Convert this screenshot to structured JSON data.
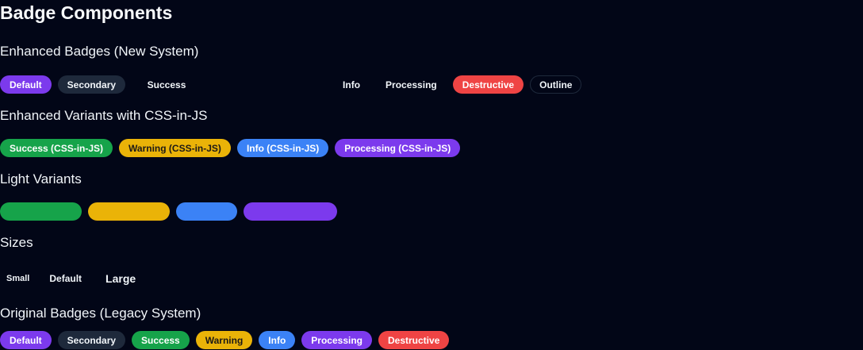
{
  "page": {
    "title": "Badge Components"
  },
  "enhanced": {
    "heading": "Enhanced Badges (New System)",
    "badges": {
      "default": "Default",
      "secondary": "Secondary",
      "success": "Success",
      "warning": "",
      "info": "Info",
      "processing": "Processing",
      "destructive": "Destructive",
      "outline": "Outline"
    }
  },
  "css_in_js": {
    "heading": "Enhanced Variants with CSS-in-JS",
    "badges": {
      "success": "Success (CSS-in-JS)",
      "warning": "Warning (CSS-in-JS)",
      "info": "Info (CSS-in-JS)",
      "processing": "Processing (CSS-in-JS)"
    }
  },
  "light": {
    "heading": "Light Variants"
  },
  "sizes": {
    "heading": "Sizes",
    "small": "Small",
    "default": "Default",
    "large": "Large"
  },
  "legacy": {
    "heading": "Original Badges (Legacy System)",
    "badges": {
      "default": "Default",
      "secondary": "Secondary",
      "success": "Success",
      "warning": "Warning",
      "info": "Info",
      "processing": "Processing",
      "destructive": "Destructive"
    }
  },
  "colors": {
    "background": "#020617",
    "default": "#7c3aed",
    "secondary": "#1e293b",
    "success": "#16a34a",
    "warning": "#eab308",
    "info": "#3b82f6",
    "processing": "#7c3aed",
    "destructive": "#ef4444"
  }
}
